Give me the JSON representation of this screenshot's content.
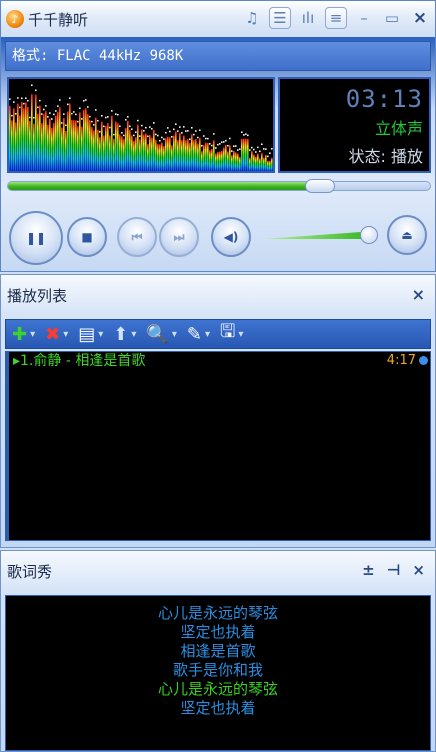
{
  "app": {
    "title": "千千静听",
    "logo_icon": "qianqian-logo-icon"
  },
  "titlebar": {
    "icons": [
      "music-note-icon",
      "playlist-icon",
      "equalizer-icon",
      "list-icon",
      "minimize-icon",
      "shade-icon",
      "close-icon"
    ],
    "close_label": "×",
    "minimize_label": "–",
    "shade_label": "▭",
    "note_label": "♫",
    "eq_label": "ılı",
    "pl_label": "≡",
    "ly_label": "☰"
  },
  "info": {
    "format_text": "格式: FLAC 44kHz 968K"
  },
  "display": {
    "time": "03:13",
    "channel": "立体声",
    "status": "状态: 播放"
  },
  "playback": {
    "progress_fraction": 0.74,
    "volume_fraction": 0.95
  },
  "controls": {
    "pause_label": "❚❚",
    "stop_label": "■",
    "prev_label": "⏮",
    "next_label": "⏭",
    "mute_label": "◀)",
    "eject_label": "⏏"
  },
  "playlist": {
    "title": "播放列表",
    "close_label": "×",
    "tools": [
      {
        "name": "add",
        "glyph": "✚",
        "color": "#3ad32e"
      },
      {
        "name": "delete",
        "glyph": "✖",
        "color": "#ff3b2f"
      },
      {
        "name": "list",
        "glyph": "▤",
        "color": "#ffffff"
      },
      {
        "name": "sort",
        "glyph": "⬆",
        "color": "#cfe6ff"
      },
      {
        "name": "search",
        "glyph": "🔍",
        "color": "#ffffff"
      },
      {
        "name": "edit",
        "glyph": "✎",
        "color": "#ffffff"
      },
      {
        "name": "save",
        "glyph": "🖫",
        "color": "#ffffff"
      }
    ],
    "items": [
      {
        "index": "▸1.",
        "title": "俞静 - 相逢是首歌",
        "duration": "4:17"
      }
    ]
  },
  "lyrics": {
    "title": "歌词秀",
    "icons": [
      "pin-icon",
      "detach-icon",
      "close-icon"
    ],
    "pin_label": "±",
    "detach_label": "⊣",
    "close_label": "×",
    "current_index": 4,
    "lines": [
      "心儿是永远的琴弦",
      "坚定也执着",
      "相逢是首歌",
      "歌手是你和我",
      "心儿是永远的琴弦",
      "坚定也执着"
    ]
  },
  "colors": {
    "accent": "#2d63c2",
    "playing_text": "#42d42a",
    "lyrics_text": "#2a8ee0",
    "duration": "#f0a820"
  }
}
